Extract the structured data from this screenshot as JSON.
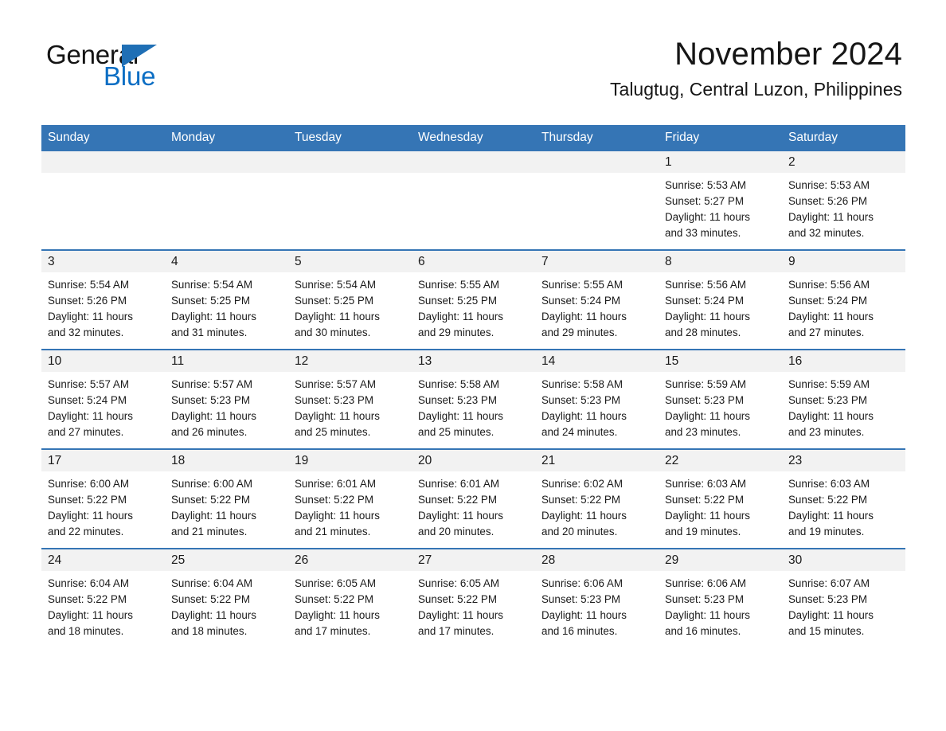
{
  "brand": {
    "name_part1": "General",
    "name_part2": "Blue",
    "triangle_color": "#1f6fb5",
    "blue_text_color": "#0b6ec4"
  },
  "header": {
    "title": "November 2024",
    "subtitle": "Talugtug, Central Luzon, Philippines",
    "header_bg_color": "#3575b5",
    "daynum_bg_color": "#f2f2f2"
  },
  "weekday_headers": [
    "Sunday",
    "Monday",
    "Tuesday",
    "Wednesday",
    "Thursday",
    "Friday",
    "Saturday"
  ],
  "weeks": [
    {
      "days": [
        {
          "num": "",
          "sunrise": "",
          "sunset": "",
          "daylight_line1": "",
          "daylight_line2": ""
        },
        {
          "num": "",
          "sunrise": "",
          "sunset": "",
          "daylight_line1": "",
          "daylight_line2": ""
        },
        {
          "num": "",
          "sunrise": "",
          "sunset": "",
          "daylight_line1": "",
          "daylight_line2": ""
        },
        {
          "num": "",
          "sunrise": "",
          "sunset": "",
          "daylight_line1": "",
          "daylight_line2": ""
        },
        {
          "num": "",
          "sunrise": "",
          "sunset": "",
          "daylight_line1": "",
          "daylight_line2": ""
        },
        {
          "num": "1",
          "sunrise": "Sunrise: 5:53 AM",
          "sunset": "Sunset: 5:27 PM",
          "daylight_line1": "Daylight: 11 hours",
          "daylight_line2": "and 33 minutes."
        },
        {
          "num": "2",
          "sunrise": "Sunrise: 5:53 AM",
          "sunset": "Sunset: 5:26 PM",
          "daylight_line1": "Daylight: 11 hours",
          "daylight_line2": "and 32 minutes."
        }
      ]
    },
    {
      "days": [
        {
          "num": "3",
          "sunrise": "Sunrise: 5:54 AM",
          "sunset": "Sunset: 5:26 PM",
          "daylight_line1": "Daylight: 11 hours",
          "daylight_line2": "and 32 minutes."
        },
        {
          "num": "4",
          "sunrise": "Sunrise: 5:54 AM",
          "sunset": "Sunset: 5:25 PM",
          "daylight_line1": "Daylight: 11 hours",
          "daylight_line2": "and 31 minutes."
        },
        {
          "num": "5",
          "sunrise": "Sunrise: 5:54 AM",
          "sunset": "Sunset: 5:25 PM",
          "daylight_line1": "Daylight: 11 hours",
          "daylight_line2": "and 30 minutes."
        },
        {
          "num": "6",
          "sunrise": "Sunrise: 5:55 AM",
          "sunset": "Sunset: 5:25 PM",
          "daylight_line1": "Daylight: 11 hours",
          "daylight_line2": "and 29 minutes."
        },
        {
          "num": "7",
          "sunrise": "Sunrise: 5:55 AM",
          "sunset": "Sunset: 5:24 PM",
          "daylight_line1": "Daylight: 11 hours",
          "daylight_line2": "and 29 minutes."
        },
        {
          "num": "8",
          "sunrise": "Sunrise: 5:56 AM",
          "sunset": "Sunset: 5:24 PM",
          "daylight_line1": "Daylight: 11 hours",
          "daylight_line2": "and 28 minutes."
        },
        {
          "num": "9",
          "sunrise": "Sunrise: 5:56 AM",
          "sunset": "Sunset: 5:24 PM",
          "daylight_line1": "Daylight: 11 hours",
          "daylight_line2": "and 27 minutes."
        }
      ]
    },
    {
      "days": [
        {
          "num": "10",
          "sunrise": "Sunrise: 5:57 AM",
          "sunset": "Sunset: 5:24 PM",
          "daylight_line1": "Daylight: 11 hours",
          "daylight_line2": "and 27 minutes."
        },
        {
          "num": "11",
          "sunrise": "Sunrise: 5:57 AM",
          "sunset": "Sunset: 5:23 PM",
          "daylight_line1": "Daylight: 11 hours",
          "daylight_line2": "and 26 minutes."
        },
        {
          "num": "12",
          "sunrise": "Sunrise: 5:57 AM",
          "sunset": "Sunset: 5:23 PM",
          "daylight_line1": "Daylight: 11 hours",
          "daylight_line2": "and 25 minutes."
        },
        {
          "num": "13",
          "sunrise": "Sunrise: 5:58 AM",
          "sunset": "Sunset: 5:23 PM",
          "daylight_line1": "Daylight: 11 hours",
          "daylight_line2": "and 25 minutes."
        },
        {
          "num": "14",
          "sunrise": "Sunrise: 5:58 AM",
          "sunset": "Sunset: 5:23 PM",
          "daylight_line1": "Daylight: 11 hours",
          "daylight_line2": "and 24 minutes."
        },
        {
          "num": "15",
          "sunrise": "Sunrise: 5:59 AM",
          "sunset": "Sunset: 5:23 PM",
          "daylight_line1": "Daylight: 11 hours",
          "daylight_line2": "and 23 minutes."
        },
        {
          "num": "16",
          "sunrise": "Sunrise: 5:59 AM",
          "sunset": "Sunset: 5:23 PM",
          "daylight_line1": "Daylight: 11 hours",
          "daylight_line2": "and 23 minutes."
        }
      ]
    },
    {
      "days": [
        {
          "num": "17",
          "sunrise": "Sunrise: 6:00 AM",
          "sunset": "Sunset: 5:22 PM",
          "daylight_line1": "Daylight: 11 hours",
          "daylight_line2": "and 22 minutes."
        },
        {
          "num": "18",
          "sunrise": "Sunrise: 6:00 AM",
          "sunset": "Sunset: 5:22 PM",
          "daylight_line1": "Daylight: 11 hours",
          "daylight_line2": "and 21 minutes."
        },
        {
          "num": "19",
          "sunrise": "Sunrise: 6:01 AM",
          "sunset": "Sunset: 5:22 PM",
          "daylight_line1": "Daylight: 11 hours",
          "daylight_line2": "and 21 minutes."
        },
        {
          "num": "20",
          "sunrise": "Sunrise: 6:01 AM",
          "sunset": "Sunset: 5:22 PM",
          "daylight_line1": "Daylight: 11 hours",
          "daylight_line2": "and 20 minutes."
        },
        {
          "num": "21",
          "sunrise": "Sunrise: 6:02 AM",
          "sunset": "Sunset: 5:22 PM",
          "daylight_line1": "Daylight: 11 hours",
          "daylight_line2": "and 20 minutes."
        },
        {
          "num": "22",
          "sunrise": "Sunrise: 6:03 AM",
          "sunset": "Sunset: 5:22 PM",
          "daylight_line1": "Daylight: 11 hours",
          "daylight_line2": "and 19 minutes."
        },
        {
          "num": "23",
          "sunrise": "Sunrise: 6:03 AM",
          "sunset": "Sunset: 5:22 PM",
          "daylight_line1": "Daylight: 11 hours",
          "daylight_line2": "and 19 minutes."
        }
      ]
    },
    {
      "days": [
        {
          "num": "24",
          "sunrise": "Sunrise: 6:04 AM",
          "sunset": "Sunset: 5:22 PM",
          "daylight_line1": "Daylight: 11 hours",
          "daylight_line2": "and 18 minutes."
        },
        {
          "num": "25",
          "sunrise": "Sunrise: 6:04 AM",
          "sunset": "Sunset: 5:22 PM",
          "daylight_line1": "Daylight: 11 hours",
          "daylight_line2": "and 18 minutes."
        },
        {
          "num": "26",
          "sunrise": "Sunrise: 6:05 AM",
          "sunset": "Sunset: 5:22 PM",
          "daylight_line1": "Daylight: 11 hours",
          "daylight_line2": "and 17 minutes."
        },
        {
          "num": "27",
          "sunrise": "Sunrise: 6:05 AM",
          "sunset": "Sunset: 5:22 PM",
          "daylight_line1": "Daylight: 11 hours",
          "daylight_line2": "and 17 minutes."
        },
        {
          "num": "28",
          "sunrise": "Sunrise: 6:06 AM",
          "sunset": "Sunset: 5:23 PM",
          "daylight_line1": "Daylight: 11 hours",
          "daylight_line2": "and 16 minutes."
        },
        {
          "num": "29",
          "sunrise": "Sunrise: 6:06 AM",
          "sunset": "Sunset: 5:23 PM",
          "daylight_line1": "Daylight: 11 hours",
          "daylight_line2": "and 16 minutes."
        },
        {
          "num": "30",
          "sunrise": "Sunrise: 6:07 AM",
          "sunset": "Sunset: 5:23 PM",
          "daylight_line1": "Daylight: 11 hours",
          "daylight_line2": "and 15 minutes."
        }
      ]
    }
  ]
}
